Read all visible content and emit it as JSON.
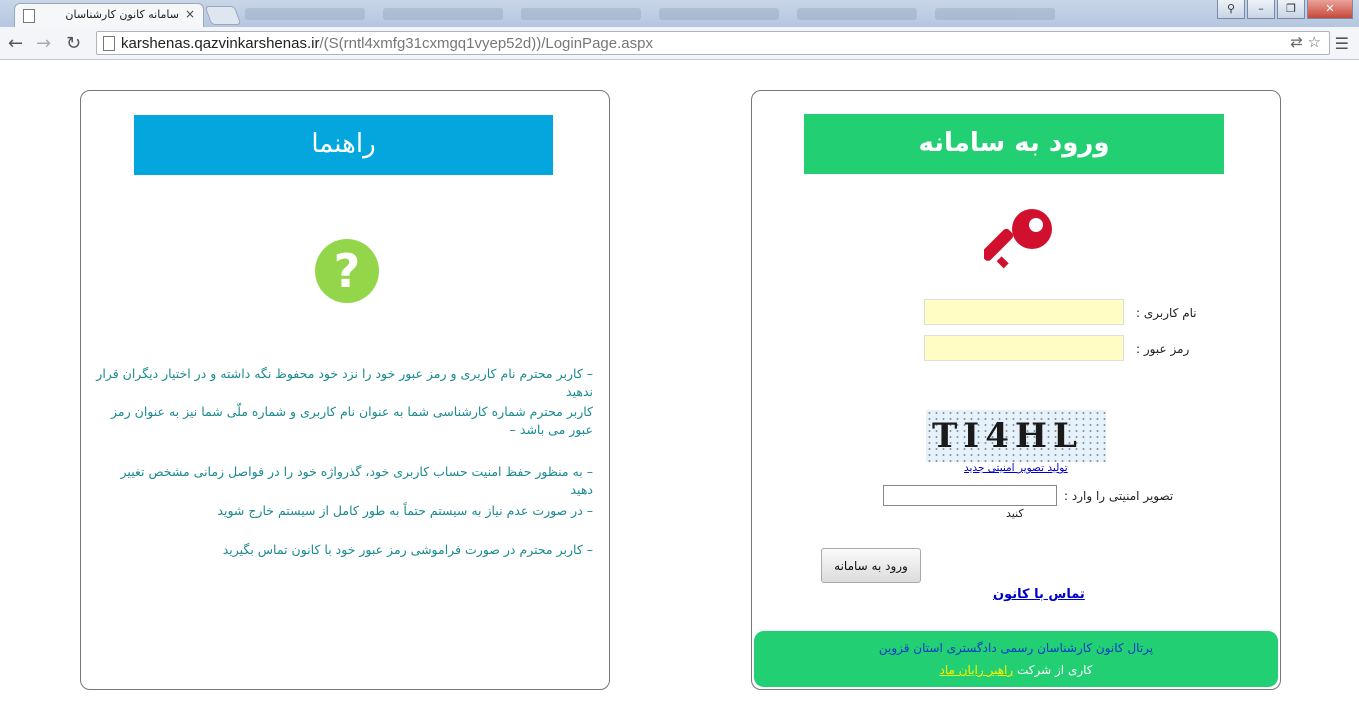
{
  "browser": {
    "tab_title": "سامانه کانون کارشناسان",
    "tab_close": "×",
    "url_host": "karshenas.qazvinkarshenas.ir",
    "url_rest": "/(S(rntl4xmfg31cxmgq1vyep52d))/LoginPage.aspx",
    "back_icon": "arrow-left-icon",
    "forward_icon": "arrow-right-icon",
    "reload_icon": "reload-icon"
  },
  "help": {
    "title": "راهنما",
    "items": [
      "– کاربر محترم نام کاربری و رمز عبور خود را نزد خود محفوظ نگه داشته و در اختیار دیگران قرار ندهید",
      "کاربر محترم شماره کارشناسی شما به عنوان نام کاربری و شماره ملّی شما نیز به عنوان رمز عبور می باشد –",
      "– به منظور حفظ امنیت حساب کاربری خود، گذرواژه خود را در فواصل زمانی مشخص تغییر دهید",
      "– در صورت عدم نیاز به سیستم حتماً به طور کامل از سیستم خارج شوید",
      "– کاربر محترم در صورت فراموشی رمز عبور خود با کانون تماس بگیرید"
    ]
  },
  "login": {
    "title": "ورود به سامانه",
    "username_label": "نام کاربری :",
    "username_value": "",
    "password_label": "رمز عبور :",
    "password_value": "",
    "captcha_text": "TI4HL",
    "captcha_refresh": "تولید تصویر امنیتی جدید",
    "captcha_label": "تصویر امنیتی را وارد :",
    "captcha_label_2": "کنید",
    "captcha_value": "",
    "submit_label": "ورود به سامانه",
    "contact_link": "تماس با کانون"
  },
  "footer": {
    "line1": "پرتال کانون کارشناسان رسمی دادگستری استان قزوین",
    "line2_prefix": "کاری از شرکت",
    "company": "راهبر رایان ماد"
  },
  "colors": {
    "help_banner": "#03a7dd",
    "login_banner": "#22cf73",
    "help_text": "#1b8a8e",
    "key": "#d0102c",
    "question": "#93d64a",
    "input_bg": "#fffcc4"
  }
}
